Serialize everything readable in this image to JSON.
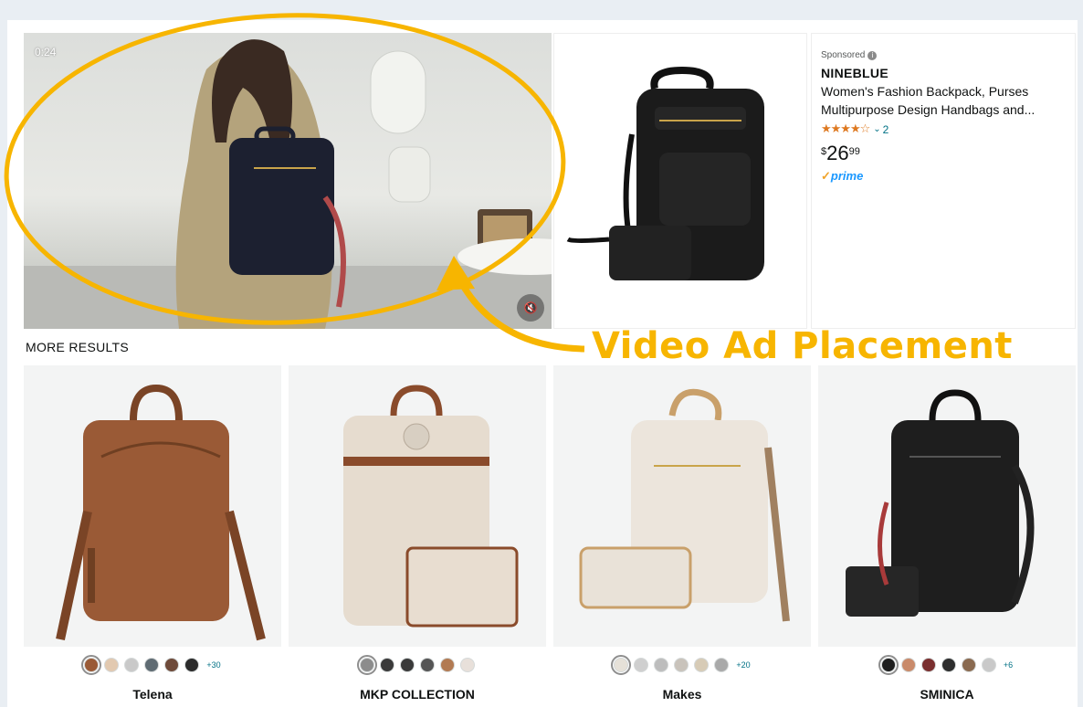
{
  "video": {
    "time": "0:24",
    "mute_icon": "speaker-mute-icon"
  },
  "ad": {
    "sponsored_label": "Sponsored",
    "info_icon": "info-icon",
    "brand": "NINEBLUE",
    "title_line1": "Women's Fashion Backpack, Purses",
    "title_line2": "Multipurpose Design Handbags and...",
    "stars": "★★★★☆",
    "rating_fraction": 0.7,
    "review_count": "2",
    "price_symbol": "$",
    "price_whole": "26",
    "price_fraction": "99",
    "prime_label": "prime",
    "prime_check": "✓"
  },
  "annotation": {
    "label": "Video Ad Placement",
    "color": "#f7b500"
  },
  "more_results": {
    "heading": "MORE RESULTS"
  },
  "products": [
    {
      "brand": "Telena",
      "bag_color": "#9a5a36",
      "swatches": [
        "#9a5a36",
        "#e2c9b0",
        "#c9c9c9",
        "#5f6b73",
        "#6e4a3a",
        "#2b2b2b"
      ],
      "more_colors": "+30"
    },
    {
      "brand": "MKP COLLECTION",
      "bag_color": "#e6dccf",
      "swatches": [
        "#8c8c8c",
        "#3a3a3a",
        "#3a3a3a",
        "#555555",
        "#b27a52",
        "#e8e0da"
      ],
      "more_colors": ""
    },
    {
      "brand": "Makes",
      "bag_color": "#ece5dc",
      "swatches": [
        "#e6e1d8",
        "#cfcfcf",
        "#bdbdbd",
        "#c9c3bb",
        "#d7cbb6",
        "#a9a9a9"
      ],
      "more_colors": "+20"
    },
    {
      "brand": "SMINICA",
      "bag_color": "#1e1e1e",
      "swatches": [
        "#1e1e1e",
        "#c98a6a",
        "#7a2f2f",
        "#2e2e2e",
        "#8a6a50",
        "#c9c9c9"
      ],
      "more_colors": "+6"
    }
  ]
}
